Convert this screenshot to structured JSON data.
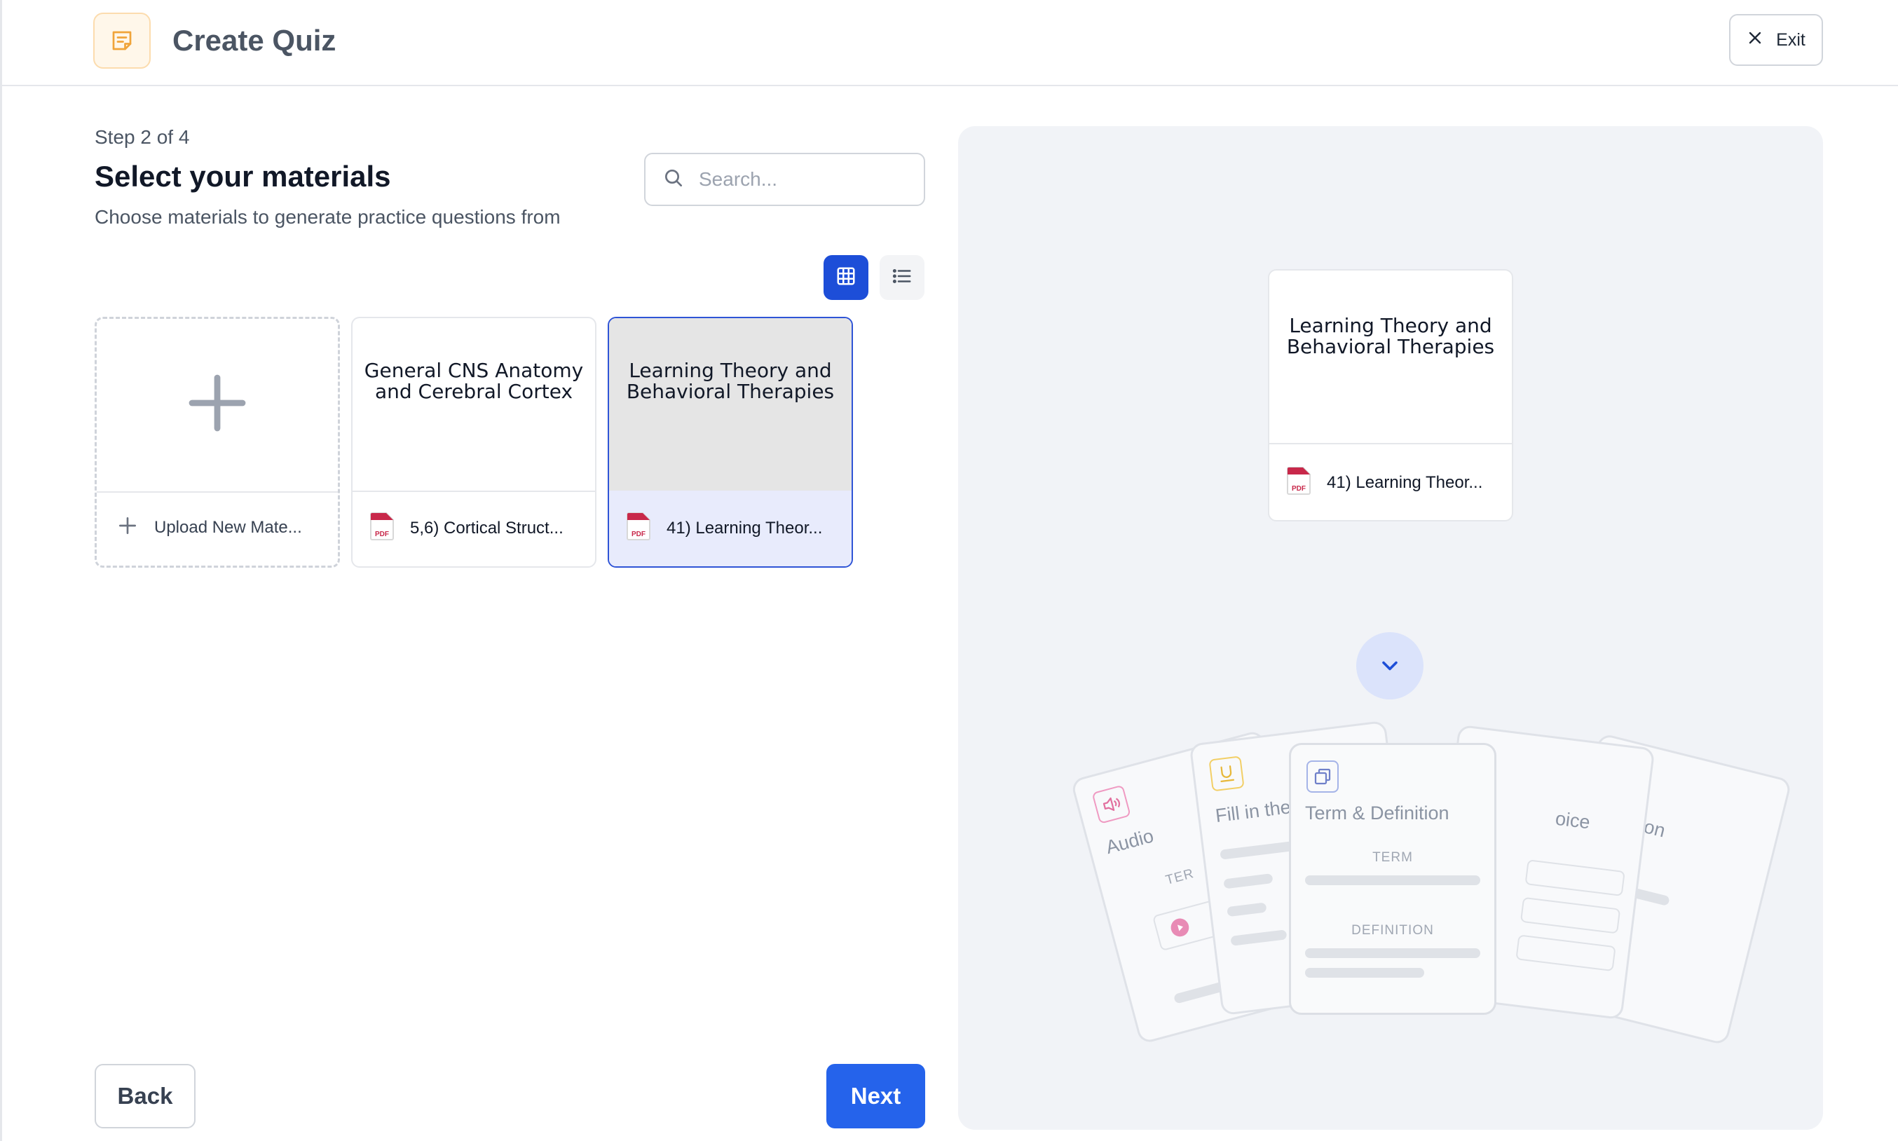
{
  "header": {
    "title": "Create Quiz",
    "exit_label": "Exit"
  },
  "step": {
    "label": "Step 2 of 4",
    "title": "Select your materials",
    "subtitle": "Choose materials to generate practice questions from"
  },
  "search": {
    "placeholder": "Search..."
  },
  "view_toggle": {
    "selected": "grid"
  },
  "materials": [
    {
      "title": "",
      "file": "Upload New Mate..."
    },
    {
      "title_line1": "General CNS Anatomy",
      "title_line2": "and Cerebral Cortex",
      "file": "5,6) Cortical Struct...",
      "file_type": "PDF"
    },
    {
      "title_line1": "Learning Theory and",
      "title_line2": "Behavioral Therapies",
      "file": "41) Learning Theor...",
      "file_type": "PDF",
      "selected": true
    }
  ],
  "preview": {
    "title_line1": "Learning Theory and",
    "title_line2": "Behavioral Therapies",
    "file": "41) Learning Theor...",
    "file_type": "PDF"
  },
  "question_types": {
    "audio": {
      "title": "Audio",
      "sub": "TER"
    },
    "fill": {
      "title": "Fill in the"
    },
    "term": {
      "title": "Term & Definition",
      "term_label": "TERM",
      "definition_label": "DEFINITION"
    },
    "choice": {
      "title": "oice"
    },
    "other": {
      "title": "on"
    }
  },
  "footer": {
    "back_label": "Back",
    "next_label": "Next"
  },
  "colors": {
    "primary": "#2563eb",
    "selected_border": "#2f54d6",
    "panel_bg": "#f1f3f7",
    "pdf_red": "#c8284a"
  }
}
